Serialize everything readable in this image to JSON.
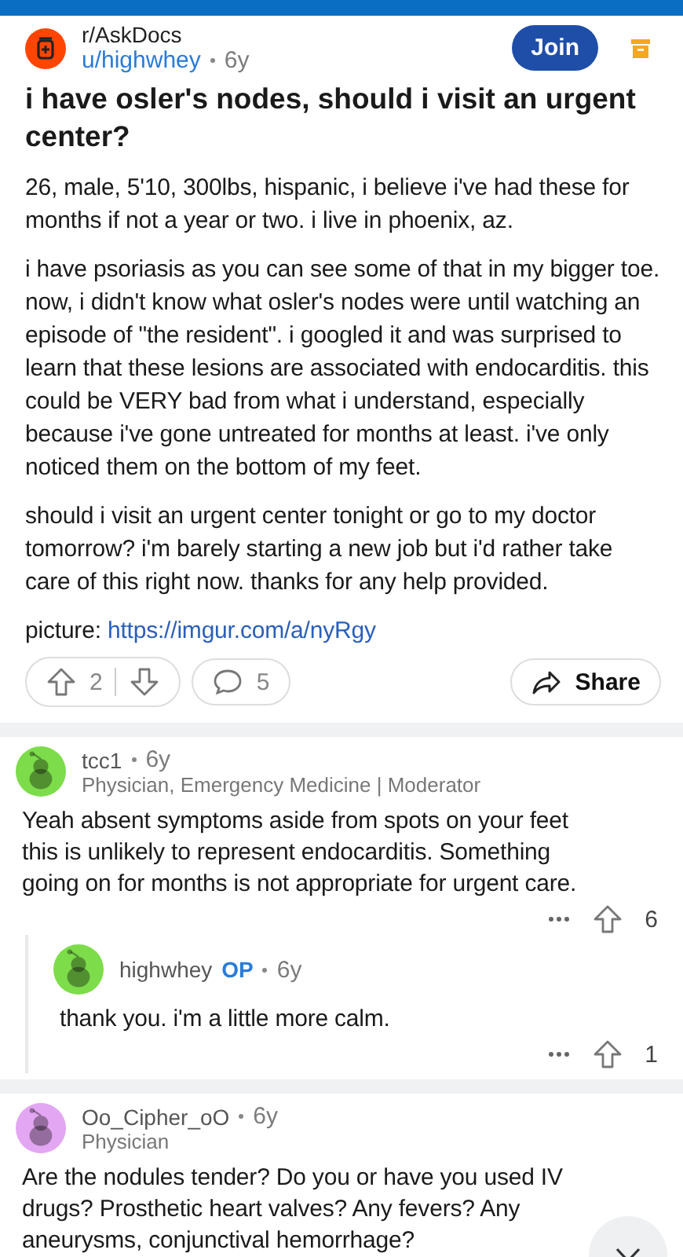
{
  "post": {
    "subreddit": "r/AskDocs",
    "author": "u/highwhey",
    "age": "6y",
    "join_label": "Join",
    "title": "i have osler's nodes, should i visit an urgent center?",
    "paragraphs": [
      "26, male, 5'10, 300lbs, hispanic, i believe i've had these for months if not a year or two. i live in phoenix, az.",
      "i have psoriasis as you can see some of that in my bigger toe. now, i didn't know what osler's nodes were until watching an episode of \"the resident\". i googled it and was surprised to learn that these lesions are associated with endocarditis. this could be VERY bad from what i understand, especially because i've gone untreated for months at least. i've only noticed them on the bottom of my feet.",
      "should i visit an urgent center tonight or go to my doctor tomorrow? i'm barely starting a new job but i'd rather take care of this right now. thanks for any help provided."
    ],
    "link_prefix": "picture:",
    "link": "https://imgur.com/a/nyRgy",
    "score": "2",
    "comments": "5",
    "share_label": "Share"
  },
  "comments": [
    {
      "author": "tcc1",
      "op": false,
      "age": "6y",
      "flair": "Physician, Emergency Medicine | Moderator",
      "color": "#7ddc4a",
      "body": "Yeah absent symptoms aside from spots on your feet this is unlikely to represent endocarditis. Something going on for months is not appropriate for urgent care.",
      "score": "6",
      "children": [
        {
          "author": "highwhey",
          "op": true,
          "op_label": "OP",
          "age": "6y",
          "color": "#7ddc4a",
          "body": "thank you. i'm a little more calm.",
          "score": "1"
        }
      ]
    },
    {
      "author": "Oo_Cipher_oO",
      "op": false,
      "age": "6y",
      "flair": "Physician",
      "color": "#e3a6f2",
      "body": "Are the nodules tender? Do you or have you used IV drugs? Prosthetic heart valves? Any fevers? Any aneurysms, conjunctival hemorrhage?"
    }
  ]
}
